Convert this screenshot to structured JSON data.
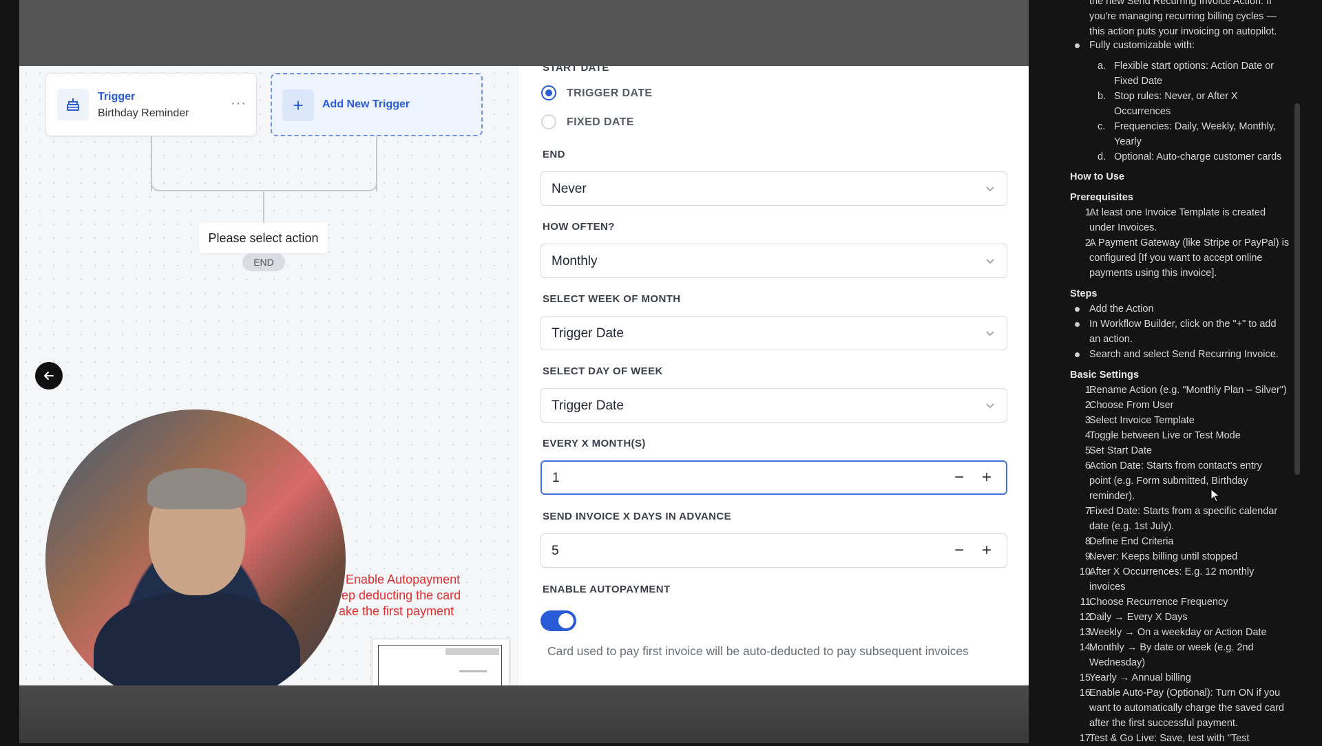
{
  "canvas": {
    "trigger": {
      "title": "Trigger",
      "subtitle": "Birthday Reminder",
      "more": "···"
    },
    "add_trigger_label": "Add New Trigger",
    "add_plus": "+",
    "select_action": "Please select action",
    "end_label": "END",
    "annotation_lines": [
      "Enable Autopayment",
      "ep deducting the card",
      "ake the first payment"
    ]
  },
  "form": {
    "start_date_label": "START DATE",
    "radio_trigger_date": "TRIGGER DATE",
    "radio_fixed_date": "FIXED DATE",
    "end_label": "END",
    "end_value": "Never",
    "how_often_label": "HOW OFTEN?",
    "how_often_value": "Monthly",
    "week_of_month_label": "SELECT WEEK OF MONTH",
    "week_of_month_value": "Trigger Date",
    "day_of_week_label": "SELECT DAY OF WEEK",
    "day_of_week_value": "Trigger Date",
    "every_x_months_label": "EVERY X MONTH(S)",
    "every_x_months_value": "1",
    "days_in_advance_label": "SEND INVOICE X DAYS IN ADVANCE",
    "days_in_advance_value": "5",
    "autopayment_label": "ENABLE AUTOPAYMENT",
    "autopayment_enabled": true,
    "autopayment_hint": "Card used to pay first invoice will be auto-deducted to pay subsequent invoices",
    "minus": "−",
    "plus": "+"
  },
  "doc": {
    "intro": [
      "the new Send Recurring Invoice Action. If",
      "you're managing recurring billing cycles —",
      "this action puts your invoicing on autopilot."
    ],
    "custom_bullet": "Fully customizable with:",
    "custom_items": [
      {
        "mark": "a.",
        "lines": [
          "Flexible start options: Action Date or",
          "Fixed Date"
        ]
      },
      {
        "mark": "b.",
        "lines": [
          "Stop rules: Never, or After X",
          "Occurrences"
        ]
      },
      {
        "mark": "c.",
        "lines": [
          "Frequencies: Daily, Weekly, Monthly,",
          "Yearly"
        ]
      },
      {
        "mark": "d.",
        "lines": [
          "Optional: Auto-charge customer cards"
        ]
      }
    ],
    "how_to_use": "How to Use",
    "prerequisites": "Prerequisites",
    "prereq_items": [
      {
        "mark": "1.",
        "lines": [
          "At least one Invoice Template is created",
          "under Invoices."
        ]
      },
      {
        "mark": "2.",
        "lines": [
          "A Payment Gateway (like Stripe or PayPal) is",
          "configured [If you want to accept online",
          "payments using this invoice]."
        ]
      }
    ],
    "steps": "Steps",
    "step_bullets": [
      [
        "Add the Action"
      ],
      [
        "In Workflow Builder, click on the \"+\" to add",
        "an action."
      ],
      [
        "Search and select Send Recurring Invoice."
      ]
    ],
    "basic_settings": "Basic Settings",
    "settings_items": [
      {
        "mark": "1.",
        "lines": [
          "Rename Action (e.g. \"Monthly Plan – Silver\")"
        ]
      },
      {
        "mark": "2.",
        "lines": [
          "Choose From User"
        ]
      },
      {
        "mark": "3.",
        "lines": [
          "Select Invoice Template"
        ]
      },
      {
        "mark": "4.",
        "lines": [
          "Toggle between Live or Test Mode"
        ]
      },
      {
        "mark": "5.",
        "lines": [
          "Set Start Date"
        ]
      },
      {
        "mark": "6.",
        "lines": [
          "Action Date: Starts from contact's entry",
          "point (e.g. Form submitted, Birthday",
          "reminder)."
        ]
      },
      {
        "mark": "7.",
        "lines": [
          "Fixed Date: Starts from a specific calendar",
          "date (e.g. 1st July)."
        ]
      },
      {
        "mark": "8.",
        "lines": [
          "Define End Criteria"
        ]
      },
      {
        "mark": "9.",
        "lines": [
          "Never: Keeps billing until stopped"
        ]
      },
      {
        "mark": "10.",
        "lines": [
          "After X Occurrences: E.g. 12 monthly",
          "invoices"
        ]
      },
      {
        "mark": "11.",
        "lines": [
          "Choose Recurrence Frequency"
        ]
      },
      {
        "mark": "12.",
        "lines": [
          "Daily → Every X Days"
        ]
      },
      {
        "mark": "13.",
        "lines": [
          "Weekly → On a weekday or Action Date"
        ]
      },
      {
        "mark": "14.",
        "lines": [
          "Monthly → By date or week (e.g. 2nd",
          "Wednesday)"
        ]
      },
      {
        "mark": "15.",
        "lines": [
          "Yearly → Annual billing"
        ]
      },
      {
        "mark": "16.",
        "lines": [
          "Enable Auto-Pay (Optional): Turn ON if you",
          "want to automatically charge the saved card",
          "after the first successful payment."
        ]
      },
      {
        "mark": "17.",
        "lines": [
          "Test & Go Live: Save, test with \"Test"
        ]
      }
    ]
  },
  "colors": {
    "accent": "#2a5bd7",
    "annotation": "#e22d2d",
    "doc_bg": "#141414"
  }
}
